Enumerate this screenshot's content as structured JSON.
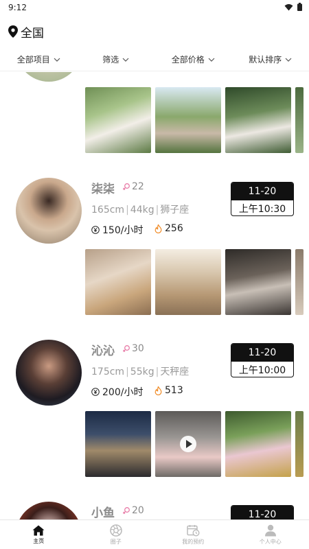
{
  "status_bar": {
    "time": "9:12"
  },
  "location": {
    "label": "全国"
  },
  "filters": [
    {
      "label": "全部项目"
    },
    {
      "label": "筛选"
    },
    {
      "label": "全部价格"
    },
    {
      "label": "默认排序"
    }
  ],
  "profiles": [
    {
      "name": "柒柒",
      "age": "22",
      "height": "165cm",
      "weight": "44kg",
      "zodiac": "狮子座",
      "price": "150/小时",
      "popularity": "256",
      "date": "11-20",
      "time": "上午10:30"
    },
    {
      "name": "沁沁",
      "age": "30",
      "height": "175cm",
      "weight": "55kg",
      "zodiac": "天秤座",
      "price": "200/小时",
      "popularity": "513",
      "date": "11-20",
      "time": "上午10:00"
    },
    {
      "name": "小鱼",
      "age": "20",
      "date": "11-20"
    }
  ],
  "tabs": [
    {
      "label": "主页"
    },
    {
      "label": "圈子"
    },
    {
      "label": "我的预约"
    },
    {
      "label": "个人中心"
    }
  ],
  "colors": {
    "accent": "#111111",
    "muted": "#8a8a8a",
    "fire": "#f08a24",
    "gender": "#e87da8"
  },
  "icons": [
    "wifi-icon",
    "battery-icon",
    "location-pin-icon",
    "chevron-down-icon",
    "female-icon",
    "yuan-icon",
    "fire-icon",
    "play-icon",
    "home-icon",
    "aperture-icon",
    "calendar-clock-icon",
    "user-icon"
  ]
}
